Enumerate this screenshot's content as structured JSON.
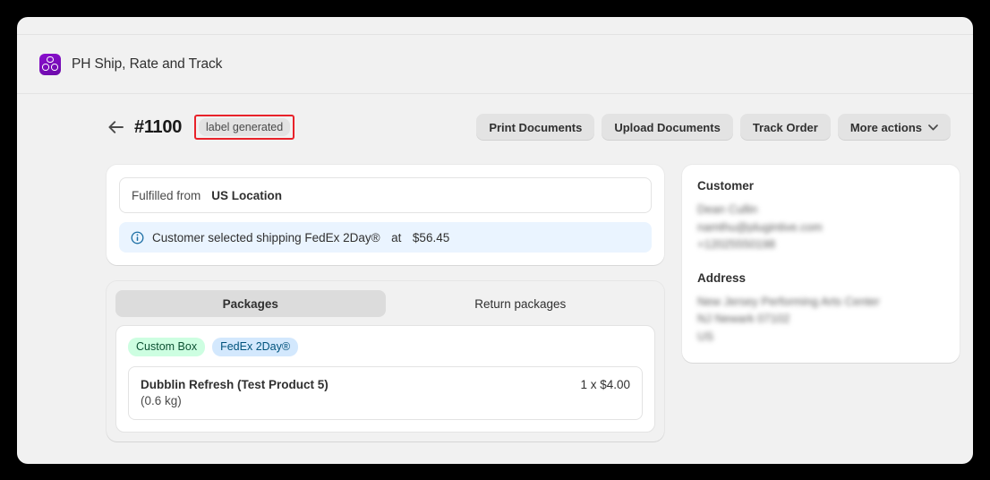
{
  "app": {
    "title": "PH Ship, Rate and Track",
    "icon": "app-trefoil-icon"
  },
  "page_header": {
    "back_icon": "arrow-left-icon",
    "order_number": "#1100",
    "status_badge": "label generated",
    "status_badge_highlight_color": "#e8222a",
    "actions": [
      {
        "label": "Print Documents",
        "icon": null
      },
      {
        "label": "Upload Documents",
        "icon": null
      },
      {
        "label": "Track Order",
        "icon": null
      },
      {
        "label": "More actions",
        "icon": "chevron-down-icon"
      }
    ]
  },
  "fulfillment": {
    "fulfilled_from_label": "Fulfilled from",
    "fulfilled_from_value": "US Location",
    "banner": {
      "icon": "info-circle-icon",
      "prefix": "Customer selected shipping",
      "service": "FedEx 2Day®",
      "at": "at",
      "price": "$56.45",
      "background": "#eaf4ff"
    }
  },
  "packages": {
    "tabs": [
      {
        "label": "Packages",
        "active": true
      },
      {
        "label": "Return packages",
        "active": false
      }
    ],
    "badges": [
      {
        "label": "Custom Box",
        "color": "#cdfee1"
      },
      {
        "label": "FedEx 2Day®",
        "color": "#d3e8fd"
      }
    ],
    "line_item": {
      "name": "Dubblin Refresh (Test Product 5)",
      "weight": "(0.6 kg)",
      "price": "1 x $4.00"
    }
  },
  "customer": {
    "title": "Customer",
    "lines": [
      "Dean Cullin",
      "namthu@plugintive.com",
      "+12025550198"
    ],
    "address_title": "Address",
    "address_lines": [
      "New Jersey Performing Arts Center",
      "NJ Newark 07102",
      "US"
    ]
  }
}
